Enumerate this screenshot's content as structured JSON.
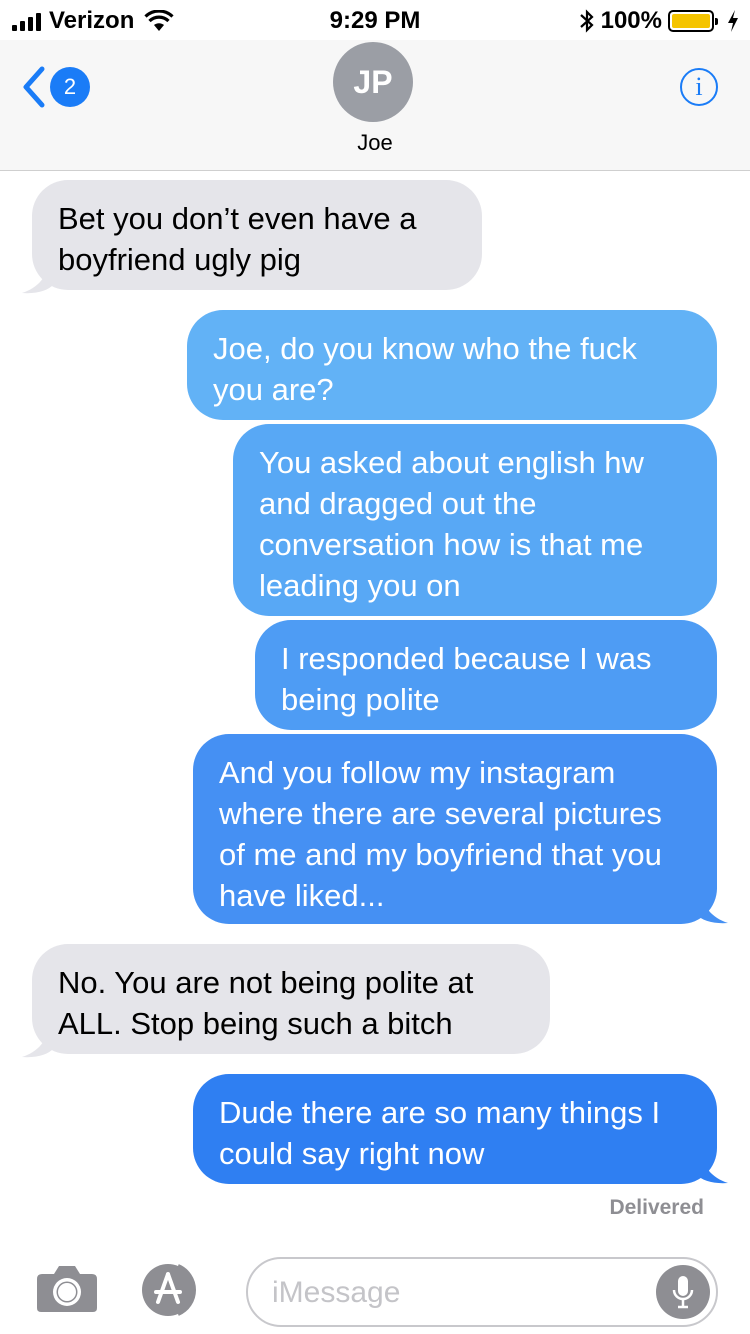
{
  "status_bar": {
    "carrier": "Verizon",
    "time": "9:29 PM",
    "battery": "100%"
  },
  "header": {
    "unread_count": "2",
    "avatar_initials": "JP",
    "contact_name": "Joe",
    "info_glyph": "i"
  },
  "messages": [
    {
      "direction": "received",
      "text": "Bet you don’t even have a boyfriend ugly pig"
    },
    {
      "direction": "sent",
      "text": "Joe, do you know who the fuck you are?"
    },
    {
      "direction": "sent",
      "text": "You asked about english hw and dragged out the conversation how is that me leading you on"
    },
    {
      "direction": "sent",
      "text": "I responded because I was being polite"
    },
    {
      "direction": "sent",
      "text": "And you follow my instagram where there are several pictures of me and my boyfriend that you have liked..."
    },
    {
      "direction": "received",
      "text": "No. You are not being polite at ALL. Stop being such a bitch"
    },
    {
      "direction": "sent",
      "text": "Dude there are so many things I could say right now"
    }
  ],
  "delivery_status": "Delivered",
  "input": {
    "placeholder": "iMessage"
  },
  "colors": {
    "imessage_blue": "#1a7cf7",
    "received_gray": "#e5e5ea"
  },
  "icons": [
    "signal-icon",
    "wifi-icon",
    "bluetooth-icon",
    "battery-icon",
    "charging-icon",
    "back-chevron-icon",
    "info-icon",
    "camera-icon",
    "app-store-icon",
    "microphone-icon"
  ]
}
